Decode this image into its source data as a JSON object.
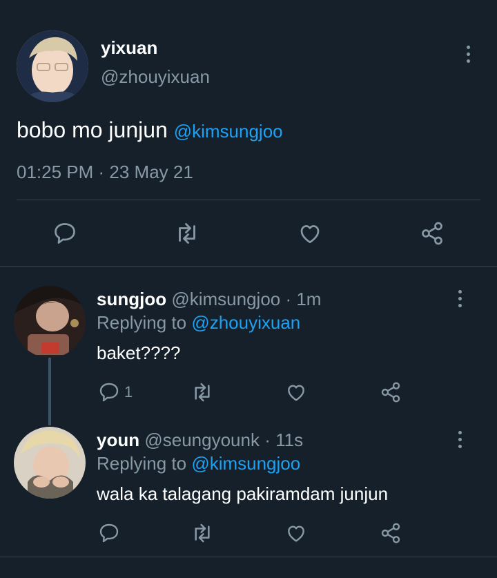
{
  "main_tweet": {
    "display_name": "yixuan",
    "handle": "@zhouyixuan",
    "text": "bobo mo junjun",
    "mention": "@kimsungjoo",
    "timestamp": "01:25 PM · 23 May 21"
  },
  "replies": [
    {
      "display_name": "sungjoo",
      "handle": "@kimsungjoo",
      "age": "· 1m",
      "replying_prefix": "Replying to",
      "replying_to": "@zhouyixuan",
      "text": "baket????",
      "reply_count": "1"
    },
    {
      "display_name": "youn",
      "handle": "@seungyounk",
      "age": "· 11s",
      "replying_prefix": "Replying to",
      "replying_to": "@kimsungjoo",
      "text": "wala ka talagang pakiramdam junjun",
      "reply_count": ""
    }
  ],
  "icons": {
    "more": "more-vertical-icon",
    "reply": "reply-bubble-icon",
    "retweet": "retweet-icon",
    "like": "heart-icon",
    "share": "share-icon"
  },
  "colors": {
    "background": "#15202b",
    "text": "#ffffff",
    "muted": "#8899a6",
    "link": "#1da1f2",
    "divider": "#38444d"
  }
}
